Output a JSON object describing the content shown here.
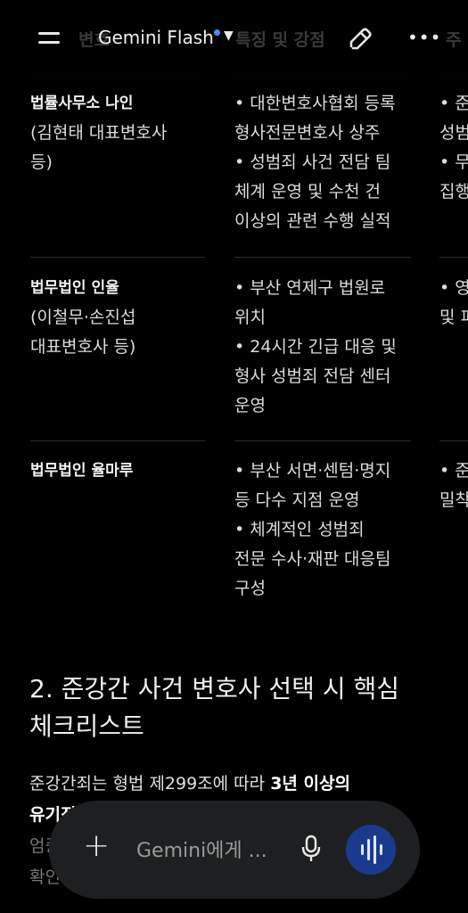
{
  "header": {
    "ghost_left": "변호",
    "title": "Gemini Flash",
    "ghost_right": "특징 및 강점",
    "ghost_far": "주"
  },
  "table": {
    "rows": [
      {
        "firm_name": "법률사무소 나인",
        "firm_rep": [
          "(김현태 대표변호사",
          "등)"
        ],
        "features": [
          "• 대한변호사협회 등록",
          "형사전문변호사 상주",
          "• 성범죄 사건 전담 팀",
          "체계 운영 및 수천 건",
          "이상의 관련 수행 실적"
        ],
        "col3": [
          "• 준",
          "성범",
          "• 무",
          "집행"
        ]
      },
      {
        "firm_name": "법무법인 인율",
        "firm_rep": [
          "(이철무·손진섭",
          "대표변호사 등)"
        ],
        "features": [
          "• 부산 연제구 법원로",
          "위치",
          "• 24시간 긴급 대응 및",
          "형사 성범죄 전담 센터",
          "운영"
        ],
        "col3": [
          "• 영",
          "및 피"
        ]
      },
      {
        "firm_name": "법무법인 율마루",
        "firm_rep": [],
        "features": [
          "• 부산 서면·센텀·명지",
          "등 다수 지점 운영",
          "• 체계적인 성범죄",
          "전문 수사·재판 대응팀",
          "구성"
        ],
        "col3": [
          "• 준",
          "밀착"
        ]
      }
    ]
  },
  "section": {
    "heading_line1": "2. 준강간 사건 변호사 선택 시 핵심",
    "heading_line2": "체크리스트",
    "para_line1_a": "준강간죄는 형법 제299조에 따라 ",
    "para_line1_b": "3년 이상의",
    "para_line2": "유기징",
    "para_line3": "엄중",
    "para_line4": "확인"
  },
  "input": {
    "placeholder": "Gemini에게 ..."
  },
  "colors": {
    "background": "#000000",
    "input_bg": "#1e1f20",
    "voice_button": "#1b3a8f",
    "model_dot": "#4c8df6"
  },
  "icons": [
    "menu-icon",
    "chevron-down-icon",
    "new-chat-pen-icon",
    "more-options-icon",
    "plus-icon",
    "microphone-icon",
    "live-voice-icon"
  ]
}
